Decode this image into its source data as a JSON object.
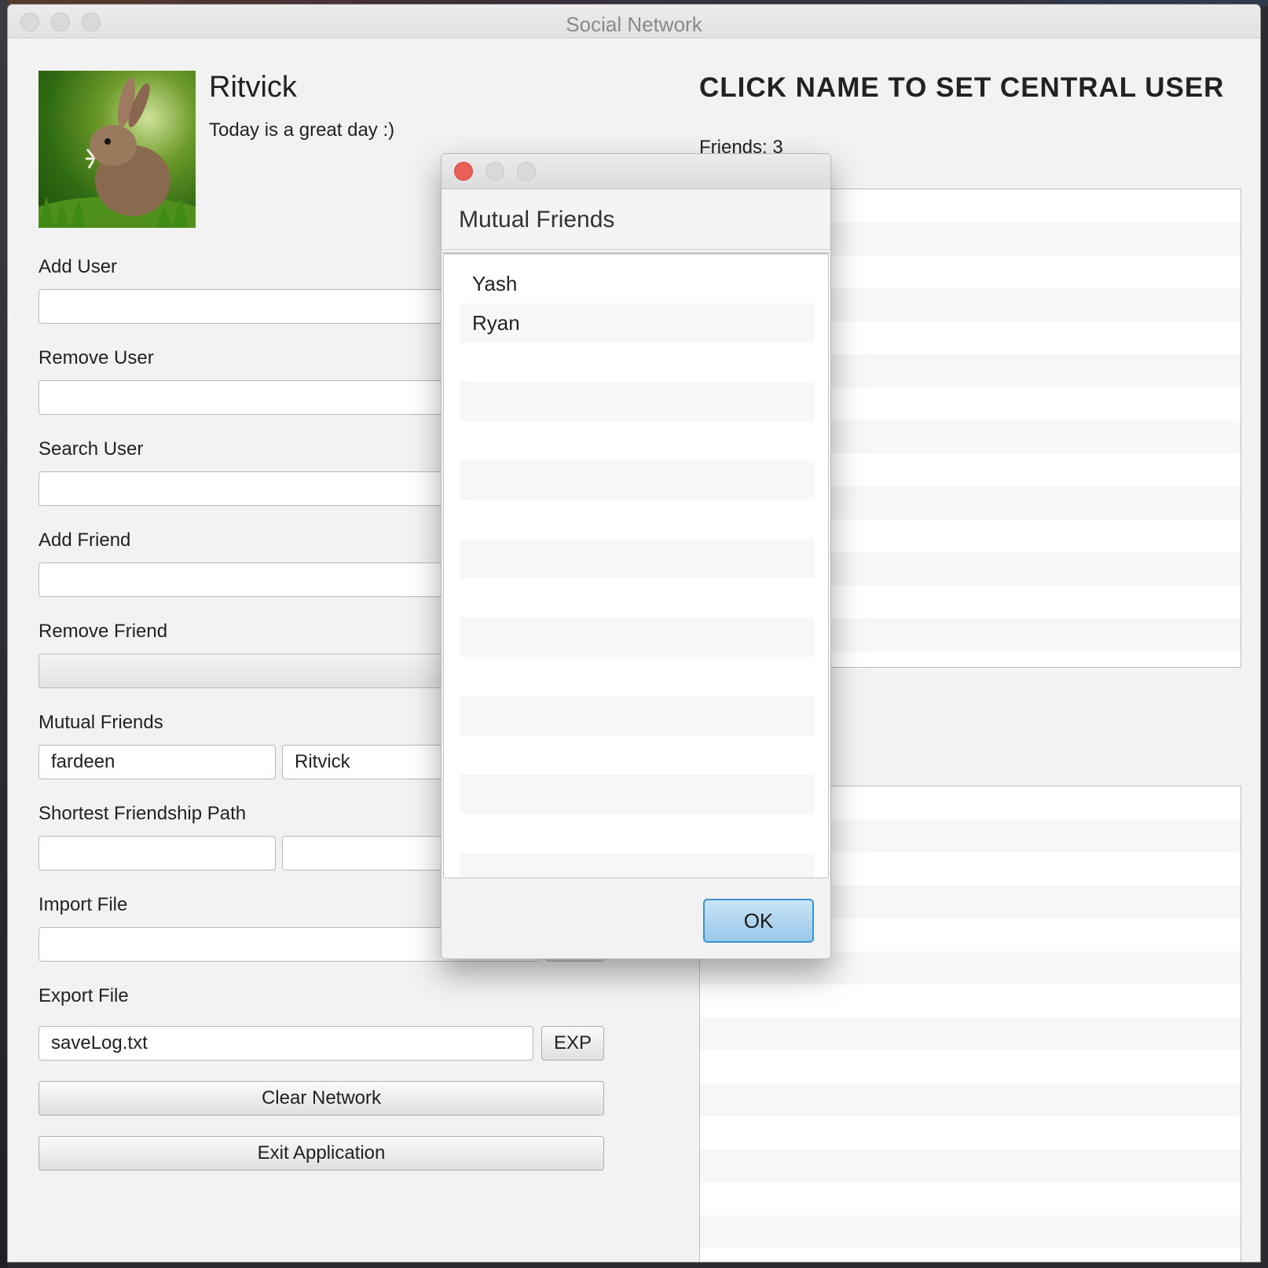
{
  "window": {
    "title": "Social Network"
  },
  "profile": {
    "name": "Ritvick",
    "status": "Today is a great day :)"
  },
  "form": {
    "add_user_label": "Add User",
    "remove_user_label": "Remove User",
    "search_user_label": "Search User",
    "add_friend_label": "Add Friend",
    "remove_friend_label": "Remove Friend",
    "mutual_friends_label": "Mutual Friends",
    "mutual_user1_value": "fardeen",
    "mutual_user2_value": "Ritvick",
    "shortest_path_label": "Shortest Friendship Path",
    "import_file_label": "Import File",
    "export_file_label": "Export File",
    "export_file_value": "saveLog.txt",
    "export_button": "EXP",
    "clear_network_button": "Clear Network",
    "exit_application_button": "Exit Application"
  },
  "right_panel": {
    "heading": "CLICK NAME TO SET CENTRAL USER",
    "friends_count": "Friends: 3"
  },
  "dialog": {
    "title": "Mutual Friends",
    "items": [
      "Yash",
      "Ryan"
    ],
    "ok_button": "OK"
  },
  "colors": {
    "close_button": "#ec5f57",
    "ok_border": "#3b93d6",
    "window_bg": "#f2f2f2"
  },
  "icons": {
    "avatar": "rabbit-photo"
  }
}
